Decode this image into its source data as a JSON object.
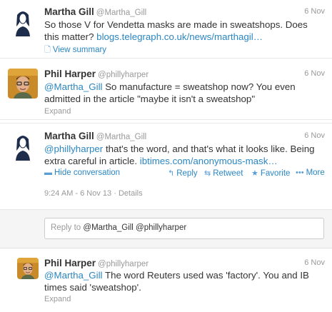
{
  "tweets": [
    {
      "fullname": "Martha Gill",
      "username": "@Martha_Gill",
      "time": "6 Nov",
      "text_plain": "So those V for Vendetta masks are made in sweatshops. Does this matter?",
      "text_link": "blogs.telegraph.co.uk/news/marthagil…",
      "summary_label": "View summary",
      "summary_icon": "document-icon",
      "avatar": "woman-illustration"
    },
    {
      "fullname": "Phil Harper",
      "username": "@phillyharper",
      "time": "6 Nov",
      "mention": "@Martha_Gill",
      "text_plain": "So manufacture = sweatshop now? You even admitted in the article \"maybe it isn't a sweatshop\"",
      "expand_label": "Expand",
      "avatar": "man-photo"
    },
    {
      "fullname": "Martha Gill",
      "username": "@Martha_Gill",
      "time": "6 Nov",
      "mention": "@phillyharper",
      "text_plain": "that's the word, and that's what it looks like. Being extra careful in article.",
      "text_link": "ibtimes.com/anonymous-mask…",
      "avatar": "woman-illustration",
      "actions": {
        "hide_conversation": "Hide conversation",
        "reply": "Reply",
        "retweet": "Retweet",
        "favorite": "Favorite",
        "more": "More"
      },
      "timestamp": "9:24 AM - 6 Nov 13",
      "details_label": "Details"
    },
    {
      "fullname": "Phil Harper",
      "username": "@phillyharper",
      "time": "6 Nov",
      "mention": "@Martha_Gill",
      "text_plain": "The word Reuters used was 'factory'. You and IB times said 'sweatshop'.",
      "expand_label": "Expand",
      "avatar": "man-photo"
    }
  ],
  "reply_box": {
    "prefix": "Reply to",
    "mentions": "@Martha_Gill @phillyharper"
  },
  "colors": {
    "link": "#2a86c2",
    "meta": "#999999",
    "text": "#333333"
  }
}
